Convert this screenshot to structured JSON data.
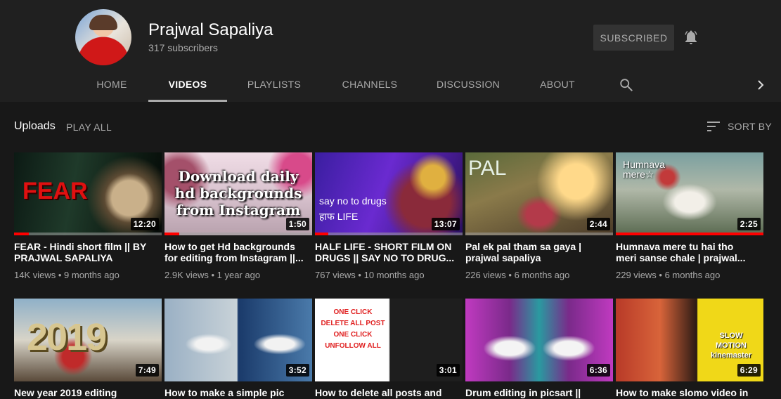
{
  "channel": {
    "name": "Prajwal Sapaliya",
    "subscribers": "317 subscribers",
    "subscribed_label": "SUBSCRIBED"
  },
  "tabs": [
    {
      "label": "HOME",
      "active": false
    },
    {
      "label": "VIDEOS",
      "active": true
    },
    {
      "label": "PLAYLISTS",
      "active": false
    },
    {
      "label": "CHANNELS",
      "active": false
    },
    {
      "label": "DISCUSSION",
      "active": false
    },
    {
      "label": "ABOUT",
      "active": false
    }
  ],
  "icons": {
    "bell": "bell-icon",
    "search": "search-icon",
    "next": "chevron-right-icon",
    "sort": "sort-icon"
  },
  "section": {
    "title": "Uploads",
    "play_all": "PLAY ALL",
    "sort_by": "SORT BY"
  },
  "colors": {
    "background": "#181818",
    "header_background": "#202020",
    "progress_red": "#ff0000",
    "secondary_text": "#aaaaaa"
  },
  "videos": [
    {
      "title": "FEAR - Hindi short film || BY PRAJWAL SAPALIYA",
      "views": "14K views",
      "age": "9 months ago",
      "duration": "12:20",
      "watched": 0.1,
      "thumb_text": "FEAR"
    },
    {
      "title": "How to get Hd backgrounds for editing from Instagram ||...",
      "views": "2.9K views",
      "age": "1 year ago",
      "duration": "1:50",
      "watched": 0.1,
      "thumb_text": "Download daily\nhd backgrounds\nfrom Instagram"
    },
    {
      "title": "HALF LIFE - SHORT FILM ON DRUGS || SAY NO TO DRUG...",
      "views": "767 views",
      "age": "10 months ago",
      "duration": "13:07",
      "watched": 0.09,
      "thumb_text": "say no to drugs\nहाफ LIFE"
    },
    {
      "title": "Pal ek pal tham sa gaya | prajwal sapaliya",
      "views": "226 views",
      "age": "6 months ago",
      "duration": "2:44",
      "watched": 0,
      "thumb_text": "PAL"
    },
    {
      "title": "Humnava mere tu hai tho meri sanse chale | prajwal...",
      "views": "229 views",
      "age": "6 months ago",
      "duration": "2:25",
      "watched": 1.0,
      "thumb_text": "Humnava\nmere☆"
    },
    {
      "title": "New year 2019 editing",
      "views": "",
      "age": "",
      "duration": "7:49",
      "watched": 0,
      "thumb_text": "2019"
    },
    {
      "title": "How to make a simple pic",
      "views": "",
      "age": "",
      "duration": "3:52",
      "watched": 0,
      "thumb_text": ""
    },
    {
      "title": "How to delete all posts and",
      "views": "",
      "age": "",
      "duration": "3:01",
      "watched": 0,
      "thumb_text": "ONE CLICK\nDELETE ALL POST\nONE CLICK\nUNFOLLOW ALL"
    },
    {
      "title": "Drum editing in picsart ||",
      "views": "",
      "age": "",
      "duration": "6:36",
      "watched": 0,
      "thumb_text": ""
    },
    {
      "title": "How to make slomo video in",
      "views": "",
      "age": "",
      "duration": "6:29",
      "watched": 0,
      "thumb_text": "SLOW\nMOTION\nkinemaster"
    }
  ]
}
